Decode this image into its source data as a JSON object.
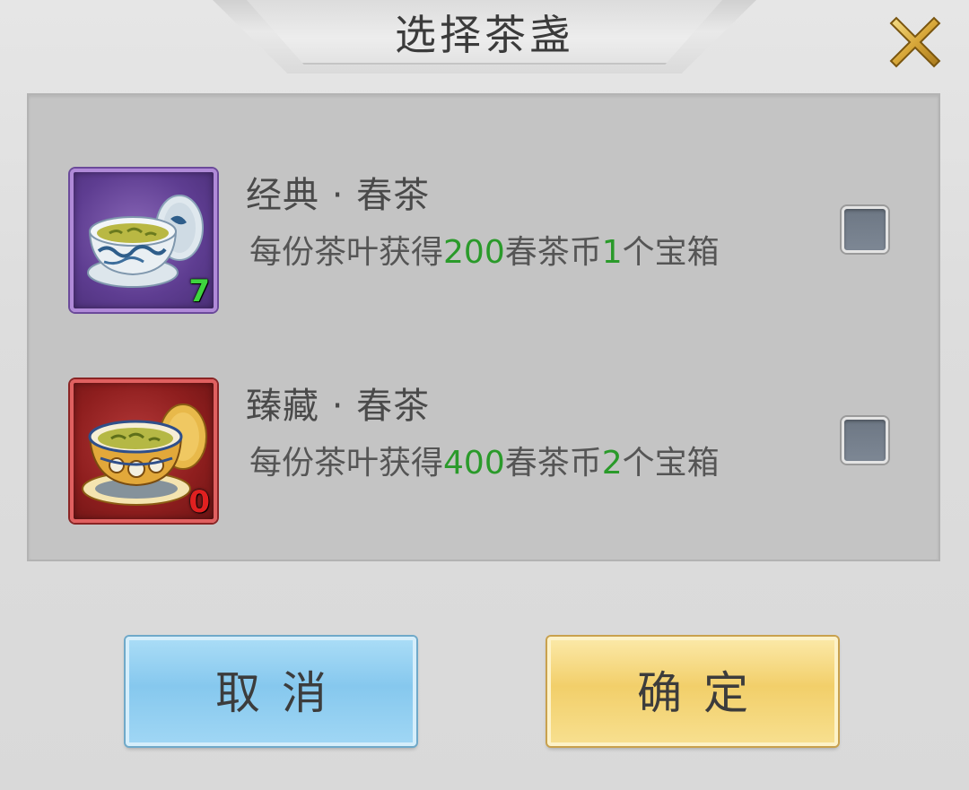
{
  "dialog": {
    "title": "选择茶盏",
    "close_icon": "close-x-icon"
  },
  "items": [
    {
      "name": "经典 · 春茶",
      "desc_prefix": "每份茶叶获得",
      "coins": "200",
      "desc_middle": "春茶币",
      "chests": "1",
      "desc_suffix": "个宝箱",
      "count": "7",
      "count_color": "#3ed43e",
      "icon": "classic-teacup-icon",
      "frame_color": "#6a4a9c",
      "checked": false
    },
    {
      "name": "臻藏 · 春茶",
      "desc_prefix": "每份茶叶获得",
      "coins": "400",
      "desc_middle": "春茶币",
      "chests": "2",
      "desc_suffix": "个宝箱",
      "count": "0",
      "count_color": "#e02020",
      "icon": "premium-teacup-icon",
      "frame_color": "#9a2020",
      "checked": false
    }
  ],
  "buttons": {
    "cancel_label": "取消",
    "confirm_label": "确定"
  },
  "colors": {
    "highlight_number": "#2a9a2a",
    "cancel_button": "#8ecbef",
    "confirm_button": "#f2cf6a"
  }
}
